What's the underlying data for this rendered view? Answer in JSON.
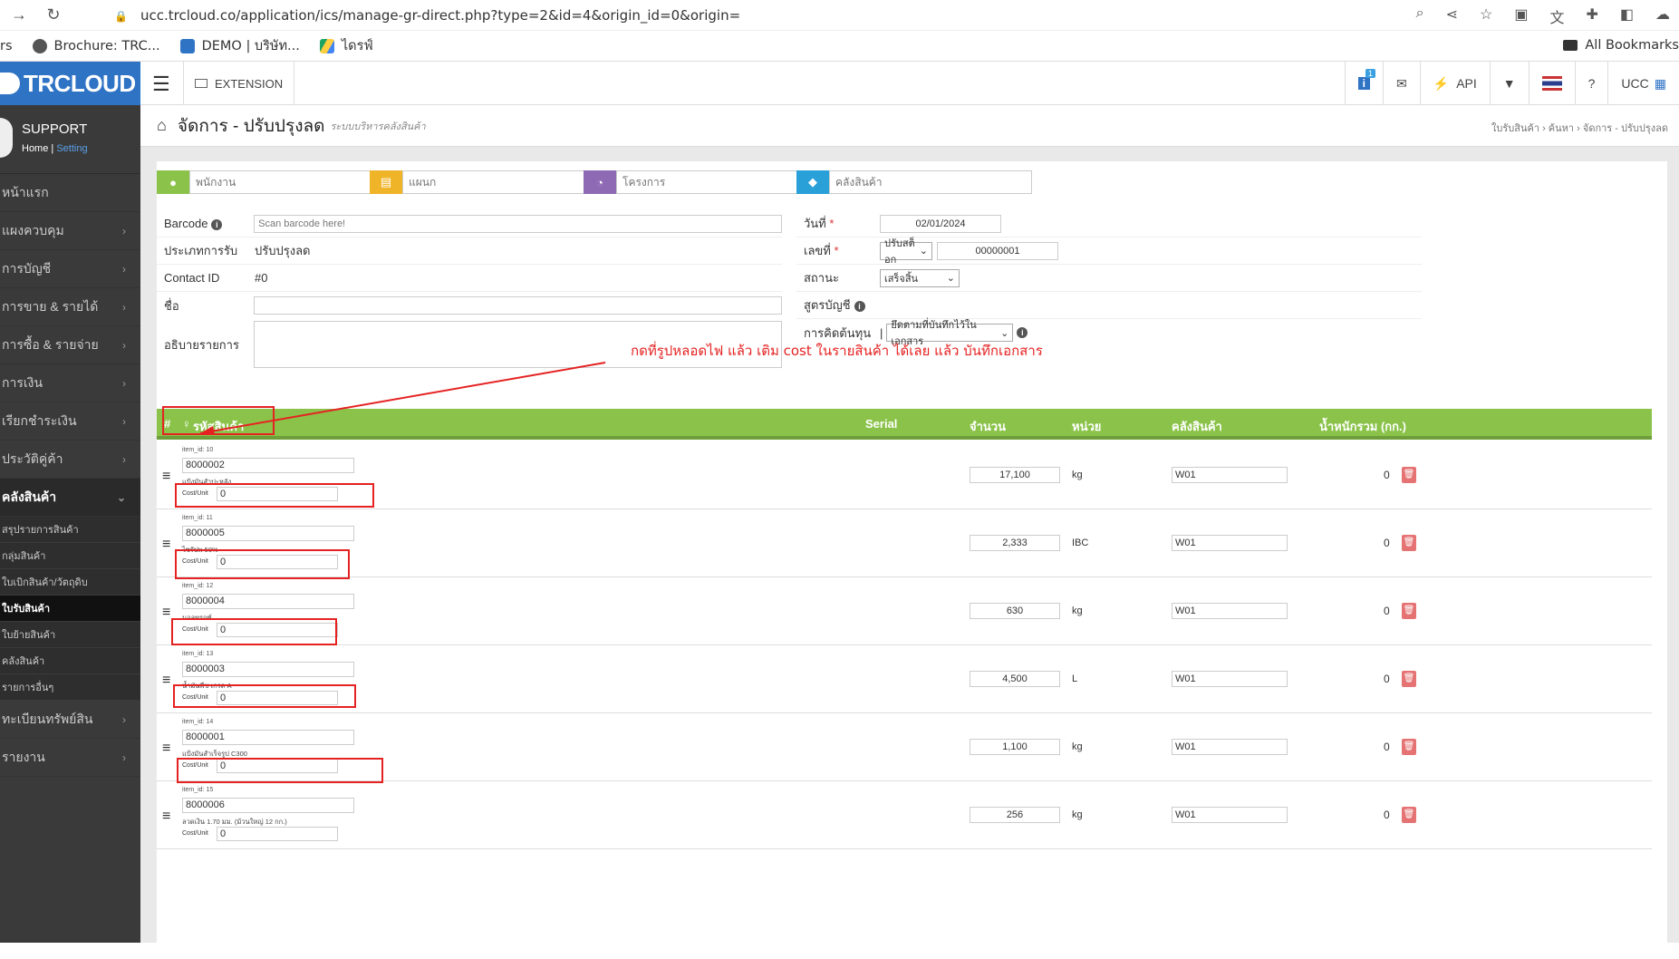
{
  "browser": {
    "url": "ucc.trcloud.co/application/ics/manage-gr-direct.php?type=2&id=4&origin_id=0&origin="
  },
  "bookmarks": {
    "items": [
      "rs",
      "Brochure: TRC...",
      "DEMO | บริษัท...",
      "ไดรฟ์"
    ],
    "right": "All Bookmarks"
  },
  "topbar": {
    "logo": "TRCLOUD",
    "extension": "EXTENSION",
    "api": "API",
    "badge": "1",
    "user": "UCC"
  },
  "profile": {
    "name": "SUPPORT",
    "home": "Home",
    "setting": "Setting"
  },
  "sidebar": {
    "items": [
      "หน้าแรก",
      "แผงควบคุม",
      "การบัญชี",
      "การขาย & รายได้",
      "การซื้อ & รายจ่าย",
      "การเงิน",
      "เรียกชำระเงิน",
      "ประวัติคู่ค้า",
      "คลังสินค้า"
    ],
    "sub": [
      "สรุปรายการสินค้า",
      "กลุ่มสินค้า",
      "ใบเบิกสินค้า/วัตถุดิบ",
      "ใบรับสินค้า",
      "ใบย้ายสินค้า",
      "คลังสินค้า",
      "รายการอื่นๆ"
    ],
    "after": [
      "ทะเบียนทรัพย์สิน",
      "รายงาน"
    ]
  },
  "page": {
    "title": "จัดการ - ปรับปรุงลด",
    "subtitle": "ระบบบริหารคลังสินค้า",
    "breadcrumb": "ใบรับสินค้า  ›  ค้นหา  ›  จัดการ - ปรับปรุงลด"
  },
  "filters": {
    "employee": "พนักงาน",
    "department": "แผนก",
    "project": "โครงการ",
    "warehouse": "คลังสินค้า"
  },
  "form": {
    "barcode_label": "Barcode",
    "barcode_placeholder": "Scan barcode here!",
    "type_label": "ประเภทการรับ",
    "type_value": "ปรับปรุงลด",
    "contact_label": "Contact ID",
    "contact_value": "#0",
    "name_label": "ชื่อ",
    "desc_label": "อธิบายรายการ",
    "date_label": "วันที่",
    "date_value": "02/01/2024",
    "number_label": "เลขที่",
    "number_select": "ปรับสต็อก",
    "number_value": "00000001",
    "status_label": "สถานะ",
    "status_value": "เสร็จสิ้น",
    "formula_label": "สูตรบัญชี",
    "cost_label": "การคิดต้นทุน",
    "cost_value": "ยึดตามที่บันทึกไว้ในเอกสาร"
  },
  "annotation": "กดที่รูปหลอดไฟ  แล้ว เติม cost ในรายสินค้า ได้เลย แล้ว บันทึกเอกสาร",
  "table": {
    "headers": {
      "hash": "#",
      "code": "รหัสสินค้า",
      "serial": "Serial",
      "qty": "จำนวน",
      "unit": "หน่วย",
      "warehouse": "คลังสินค้า",
      "weight": "น้ำหนักรวม (กก.)"
    },
    "cost_label": "Cost/Unit",
    "rows": [
      {
        "item_id": "item_id: 10",
        "code": "8000002",
        "name": "แป้งมันสำปะหลัง",
        "cost": "0",
        "qty": "17,100",
        "unit": "kg",
        "warehouse": "W01",
        "weight": "0"
      },
      {
        "item_id": "item_id: 11",
        "code": "8000005",
        "name": "ไซรัปพ 50%",
        "cost": "0",
        "qty": "2,333",
        "unit": "IBC",
        "warehouse": "W01",
        "weight": "0"
      },
      {
        "item_id": "item_id: 12",
        "code": "8000004",
        "name": "มอลทรกซ์",
        "cost": "0",
        "qty": "630",
        "unit": "kg",
        "warehouse": "W01",
        "weight": "0"
      },
      {
        "item_id": "item_id: 13",
        "code": "8000003",
        "name": "น้ำมันพืช เกรด A",
        "cost": "0",
        "qty": "4,500",
        "unit": "L",
        "warehouse": "W01",
        "weight": "0"
      },
      {
        "item_id": "item_id: 14",
        "code": "8000001",
        "name": "แป้งมันสำเร็จรูป C300",
        "cost": "0",
        "qty": "1,100",
        "unit": "kg",
        "warehouse": "W01",
        "weight": "0"
      },
      {
        "item_id": "item_id: 15",
        "code": "8000006",
        "name": "ลวดเงิน 1.70 มม. (ม้วนใหญ่ 12 กก.)",
        "cost": "0",
        "qty": "256",
        "unit": "kg",
        "warehouse": "W01",
        "weight": "0"
      }
    ]
  },
  "colors": {
    "accent": "#2f73c5",
    "table_header": "#8bc34a",
    "annotation": "#e52222",
    "sidebar": "#3a3a3a"
  }
}
